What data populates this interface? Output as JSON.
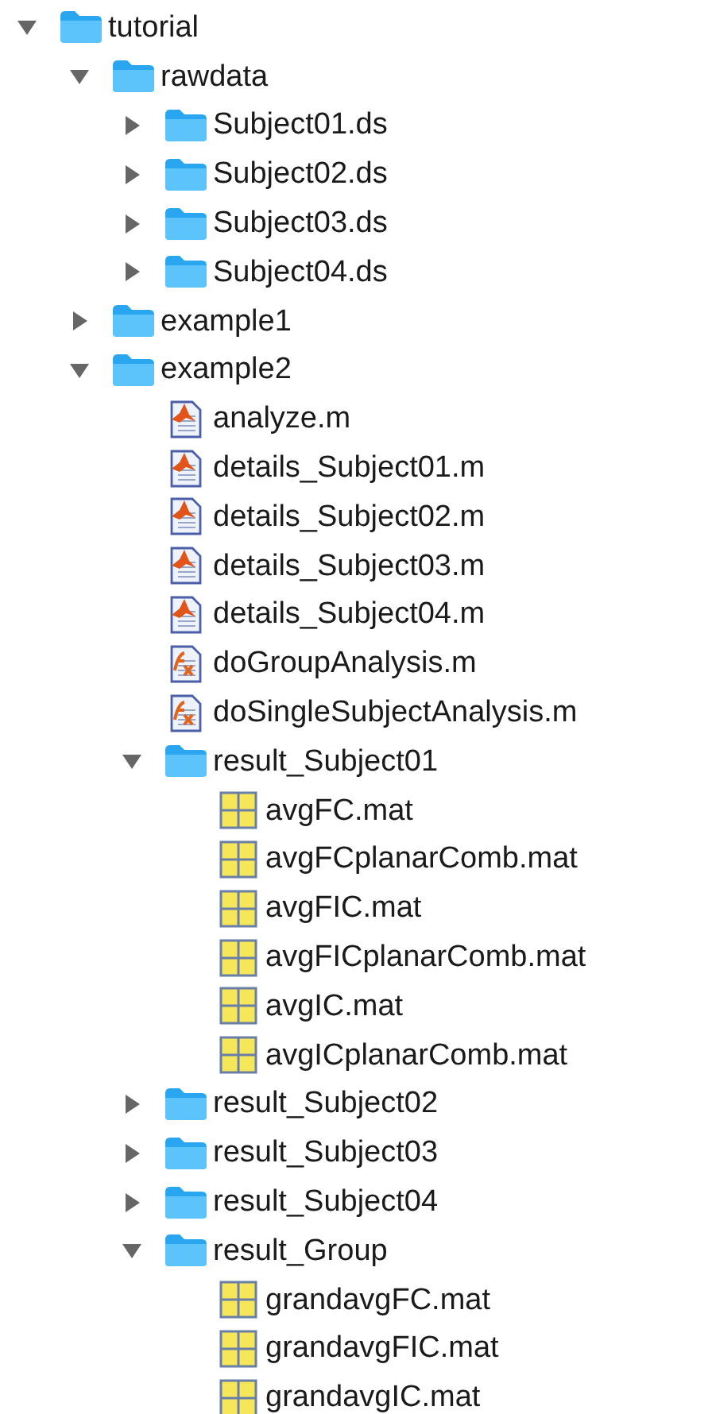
{
  "tree": [
    {
      "name": "tutorial",
      "kind": "folder",
      "expanded": true,
      "children": [
        {
          "name": "rawdata",
          "kind": "folder",
          "expanded": true,
          "children": [
            {
              "name": "Subject01.ds",
              "kind": "folder",
              "expanded": false
            },
            {
              "name": "Subject02.ds",
              "kind": "folder",
              "expanded": false
            },
            {
              "name": "Subject03.ds",
              "kind": "folder",
              "expanded": false
            },
            {
              "name": "Subject04.ds",
              "kind": "folder",
              "expanded": false
            }
          ]
        },
        {
          "name": "example1",
          "kind": "folder",
          "expanded": false
        },
        {
          "name": "example2",
          "kind": "folder",
          "expanded": true,
          "children": [
            {
              "name": "analyze.m",
              "kind": "script"
            },
            {
              "name": "details_Subject01.m",
              "kind": "script"
            },
            {
              "name": "details_Subject02.m",
              "kind": "script"
            },
            {
              "name": "details_Subject03.m",
              "kind": "script"
            },
            {
              "name": "details_Subject04.m",
              "kind": "script"
            },
            {
              "name": "doGroupAnalysis.m",
              "kind": "function"
            },
            {
              "name": "doSingleSubjectAnalysis.m",
              "kind": "function"
            },
            {
              "name": "result_Subject01",
              "kind": "folder",
              "expanded": true,
              "children": [
                {
                  "name": "avgFC.mat",
                  "kind": "mat"
                },
                {
                  "name": "avgFCplanarComb.mat",
                  "kind": "mat"
                },
                {
                  "name": "avgFIC.mat",
                  "kind": "mat"
                },
                {
                  "name": "avgFICplanarComb.mat",
                  "kind": "mat"
                },
                {
                  "name": "avgIC.mat",
                  "kind": "mat"
                },
                {
                  "name": "avgICplanarComb.mat",
                  "kind": "mat"
                }
              ]
            },
            {
              "name": "result_Subject02",
              "kind": "folder",
              "expanded": false
            },
            {
              "name": "result_Subject03",
              "kind": "folder",
              "expanded": false
            },
            {
              "name": "result_Subject04",
              "kind": "folder",
              "expanded": false
            },
            {
              "name": "result_Group",
              "kind": "folder",
              "expanded": true,
              "children": [
                {
                  "name": "grandavgFC.mat",
                  "kind": "mat"
                },
                {
                  "name": "grandavgFIC.mat",
                  "kind": "mat"
                },
                {
                  "name": "grandavgIC.mat",
                  "kind": "mat"
                }
              ]
            }
          ]
        }
      ]
    }
  ]
}
